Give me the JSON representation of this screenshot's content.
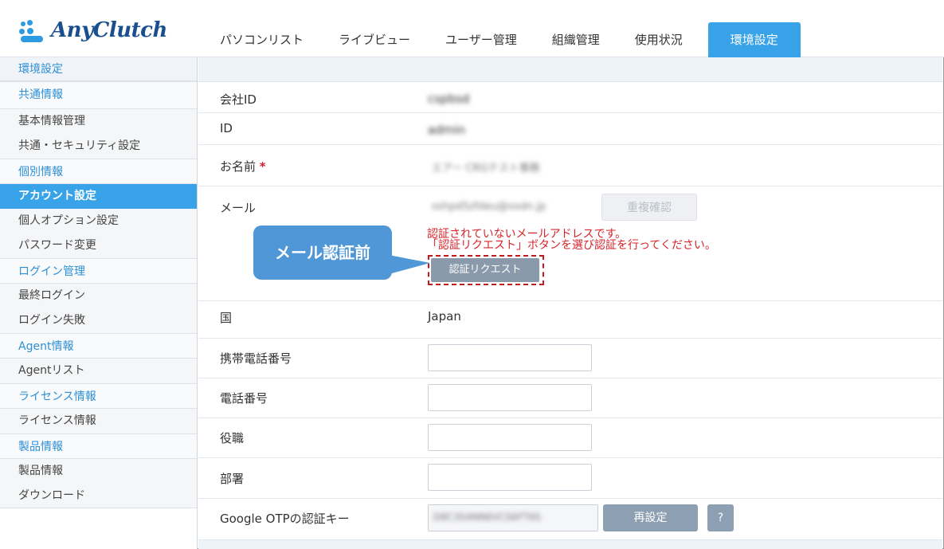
{
  "logo": {
    "text": "AnyClutch"
  },
  "nav": {
    "items": [
      "パソコンリスト",
      "ライブビュー",
      "ユーザー管理",
      "組織管理",
      "使用状況"
    ],
    "active": "環境設定"
  },
  "sidebar": {
    "title": "環境設定",
    "groups": [
      {
        "label": "共通情報",
        "items": [
          "基本情報管理",
          "共通・セキュリティ設定"
        ]
      },
      {
        "label": "個別情報",
        "items": [
          "アカウント設定",
          "個人オプション設定",
          "パスワード変更"
        ]
      },
      {
        "label": "ログイン管理",
        "items": [
          "最終ログイン",
          "ログイン失敗"
        ]
      },
      {
        "label": "Agent情報",
        "items": [
          "Agentリスト"
        ]
      },
      {
        "label": "ライセンス情報",
        "items": [
          "ライセンス情報"
        ]
      },
      {
        "label": "製品情報",
        "items": [
          "製品情報",
          "ダウンロード"
        ]
      }
    ],
    "active_item": "アカウント設定"
  },
  "form": {
    "company_id_label": "会社ID",
    "company_id_value": "cspbsd",
    "id_label": "ID",
    "id_value": "admin",
    "name_label": "お名前",
    "required_mark": "*",
    "name_value": "エアー CRGテスト事務",
    "mail_label": "メール",
    "mail_value": "sshpd5zfdeu@xxdn.jp",
    "dup_check_button": "重複確認",
    "error_line1": "認証されていないメールアドレスです。",
    "error_line2": "「認証リクエスト」ボタンを選び認証を行ってください。",
    "auth_request_button": "認証リクエスト",
    "country_label": "国",
    "country_value": "Japan",
    "mobile_label": "携帯電話番号",
    "phone_label": "電話番号",
    "position_label": "役職",
    "department_label": "部署",
    "otp_label": "Google OTPの認証キー",
    "otp_value": "D8C3S4NN6VCS6FT6S",
    "reset_button": "再設定",
    "help_button": "?"
  },
  "callout": {
    "text": "メール認証前"
  },
  "colors": {
    "accent": "#38a3e8",
    "link": "#2d8fd5",
    "error": "#d8232a",
    "callout": "#4f97d6"
  }
}
